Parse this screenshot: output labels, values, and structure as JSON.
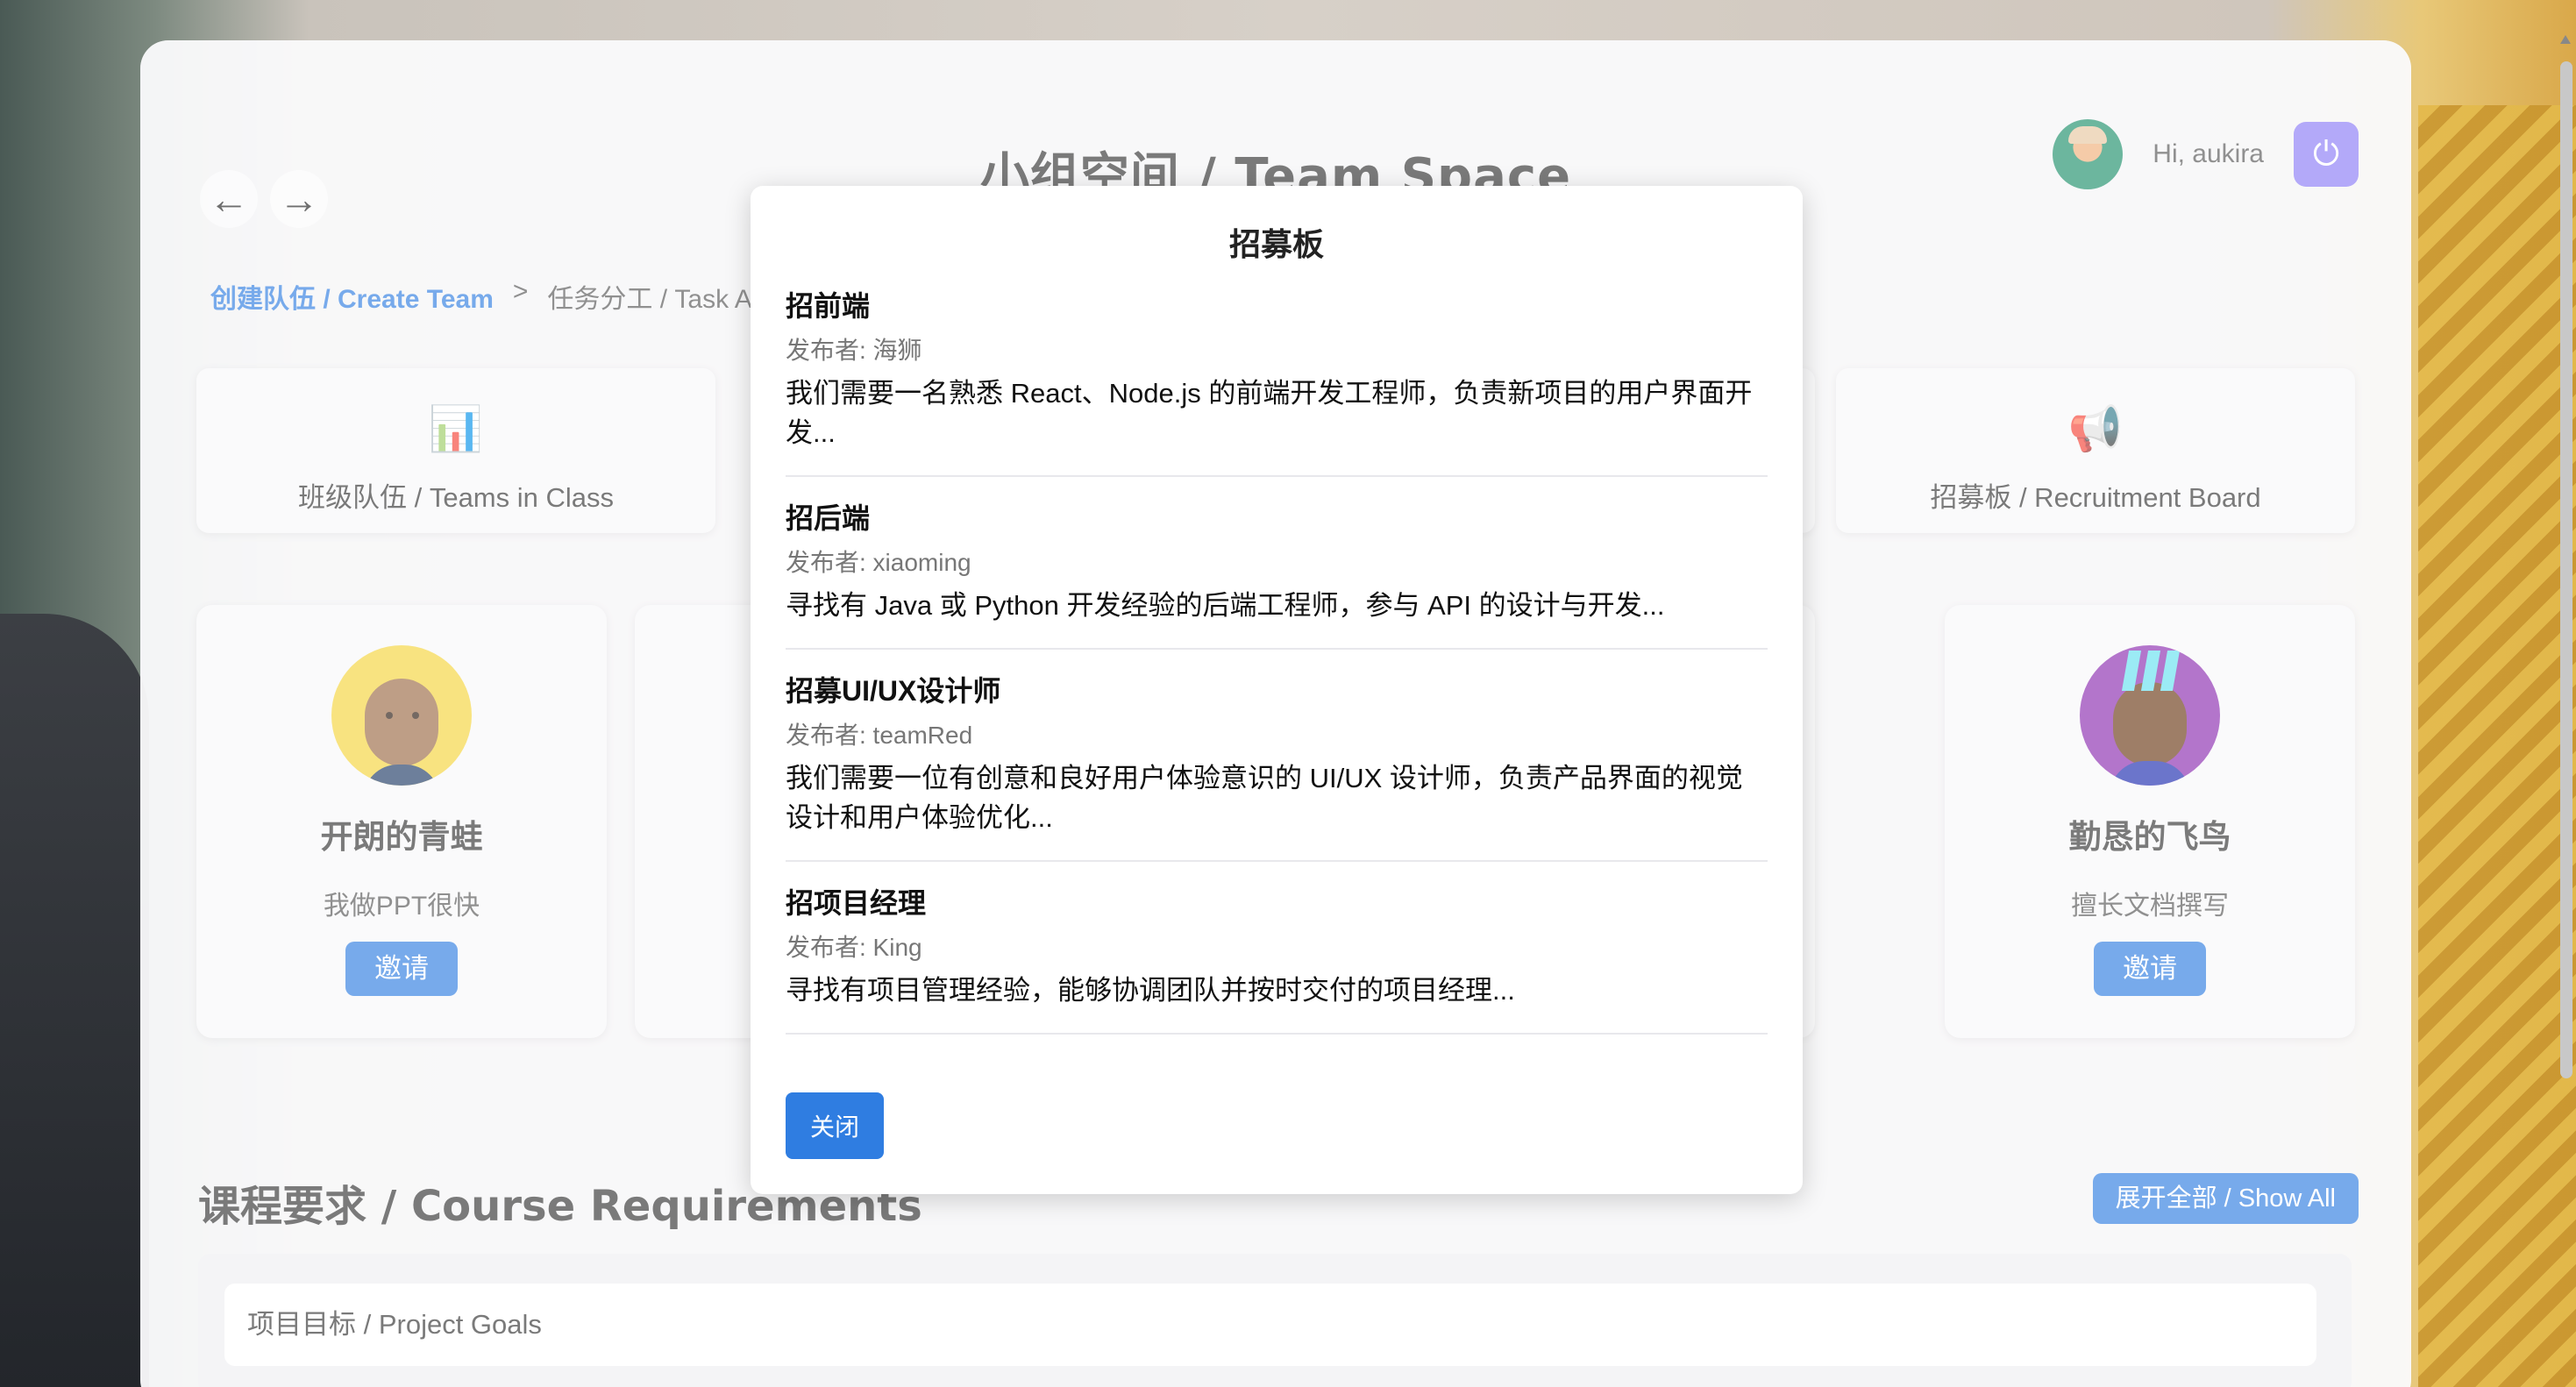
{
  "header": {
    "title": "小组空间 / Team Space",
    "greeting": "Hi, aukira",
    "back_icon": "←",
    "forward_icon": "→",
    "power_icon": "⏻"
  },
  "breadcrumb": {
    "current": "创建队伍 / Create Team",
    "separator": ">",
    "next": "任务分工 / Task As"
  },
  "tiles": [
    {
      "icon": "📊",
      "label": "班级队伍 / Teams in Class"
    },
    {
      "icon": "📢",
      "label": "招募板 / Recruitment Board"
    }
  ],
  "members": [
    {
      "name": "开朗的青蛙",
      "bio": "我做PPT很快",
      "invite": "邀请"
    },
    {
      "name": "勤恳的飞鸟",
      "bio": "擅长文档撰写",
      "invite": "邀请"
    }
  ],
  "partial_text": "队",
  "course": {
    "title": "课程要求 / Course Requirements",
    "show_all": "展开全部 / Show All",
    "first_item": "项目目标 / Project Goals"
  },
  "modal": {
    "title": "招募板",
    "close": "关闭",
    "posts": [
      {
        "title": "招前端",
        "author": "发布者: 海狮",
        "desc": "我们需要一名熟悉 React、Node.js 的前端开发工程师，负责新项目的用户界面开发..."
      },
      {
        "title": "招后端",
        "author": "发布者: xiaoming",
        "desc": "寻找有 Java 或 Python 开发经验的后端工程师，参与 API 的设计与开发..."
      },
      {
        "title": "招募UI/UX设计师",
        "author": "发布者: teamRed",
        "desc": "我们需要一位有创意和良好用户体验意识的 UI/UX 设计师，负责产品界面的视觉设计和用户体验优化..."
      },
      {
        "title": "招项目经理",
        "author": "发布者: King",
        "desc": "寻找有项目管理经验，能够协调团队并按时交付的项目经理..."
      }
    ]
  },
  "colors": {
    "accent": "#2f7de1",
    "power_button": "#8b7cf6"
  }
}
